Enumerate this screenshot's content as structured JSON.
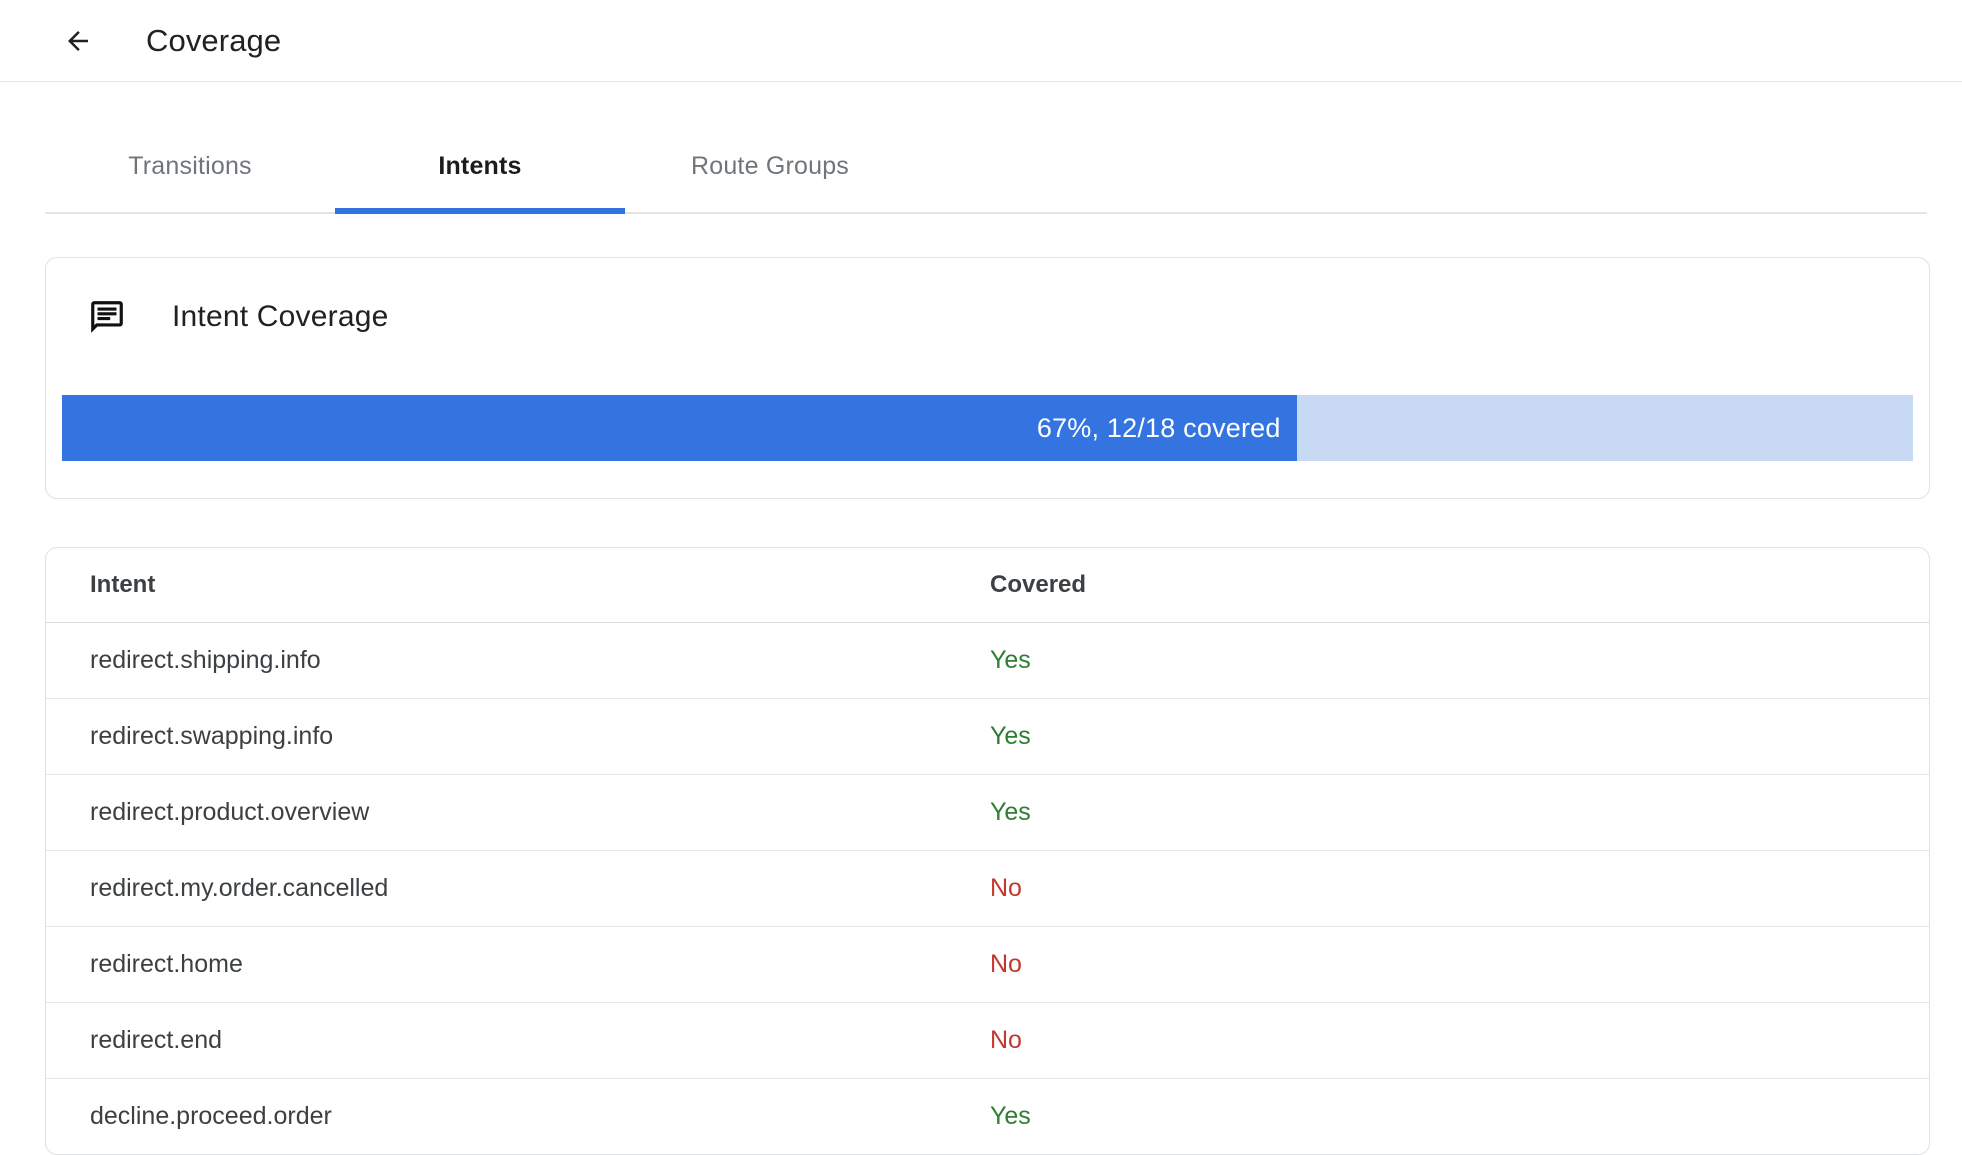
{
  "header": {
    "title": "Coverage",
    "back_icon": "arrow-back-icon"
  },
  "tabs": [
    {
      "label": "Transitions",
      "active": false
    },
    {
      "label": "Intents",
      "active": true
    },
    {
      "label": "Route Groups",
      "active": false
    }
  ],
  "coverage_card": {
    "icon": "chat-icon",
    "title": "Intent Coverage",
    "progress_label": "67%, 12/18 covered",
    "percent": 67,
    "covered": 12,
    "total": 18,
    "colors": {
      "fill_blue": "#3374e0",
      "track_blue": "#c7d9f3",
      "label_text": "#ffffff"
    }
  },
  "table": {
    "columns": [
      "Intent",
      "Covered"
    ],
    "rows": [
      {
        "intent": "redirect.shipping.info",
        "covered": "Yes"
      },
      {
        "intent": "redirect.swapping.info",
        "covered": "Yes"
      },
      {
        "intent": "redirect.product.overview",
        "covered": "Yes"
      },
      {
        "intent": "redirect.my.order.cancelled",
        "covered": "No"
      },
      {
        "intent": "redirect.home",
        "covered": "No"
      },
      {
        "intent": "redirect.end",
        "covered": "No"
      },
      {
        "intent": "decline.proceed.order",
        "covered": "Yes"
      }
    ],
    "colors": {
      "yes_green": "#2e7d32",
      "no_red": "#c5362c"
    }
  }
}
